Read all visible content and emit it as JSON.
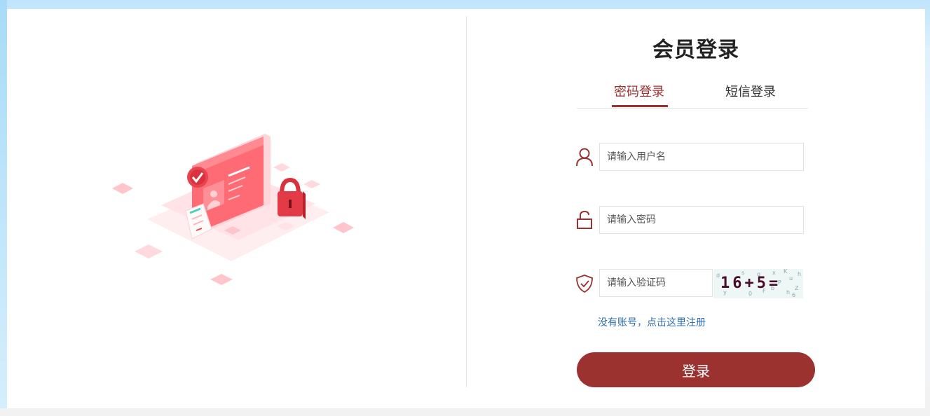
{
  "title": "会员登录",
  "tabs": [
    {
      "label": "密码登录",
      "active": true
    },
    {
      "label": "短信登录",
      "active": false
    }
  ],
  "form": {
    "username_placeholder": "请输入用户名",
    "password_placeholder": "请输入密码",
    "captcha_placeholder": "请输入验证码",
    "captcha_text": "16+5="
  },
  "register_link": "没有账号，点击这里注册",
  "login_button": "登录",
  "icons": {
    "username": "user-icon",
    "password": "lock-icon",
    "captcha": "shield-check-icon"
  },
  "colors": {
    "accent": "#9b3230",
    "link": "#2f6fb0",
    "illustration": "#ff6b6b"
  }
}
